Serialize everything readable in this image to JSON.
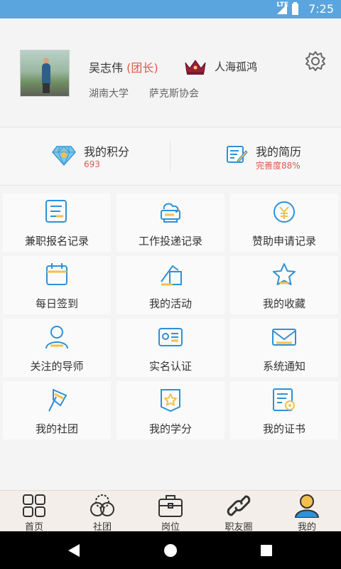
{
  "statusbar": {
    "network": "LTE",
    "time": "7:25"
  },
  "profile": {
    "name": "吴志伟",
    "role": "(团长)",
    "nickname": "人海孤鸿",
    "school": "湖南大学",
    "club": "萨克斯协会"
  },
  "stats": {
    "points_title": "我的积分",
    "points_value": "693",
    "resume_title": "我的简历",
    "resume_value": "完善度88%"
  },
  "menu": [
    {
      "label": "兼职报名记录",
      "icon": "form-record-icon"
    },
    {
      "label": "工作投递记录",
      "icon": "print-deliver-icon"
    },
    {
      "label": "赞助申请记录",
      "icon": "yuan-coin-icon"
    },
    {
      "label": "每日签到",
      "icon": "calendar-icon"
    },
    {
      "label": "我的活动",
      "icon": "activity-icon"
    },
    {
      "label": "我的收藏",
      "icon": "star-icon"
    },
    {
      "label": "关注的导师",
      "icon": "person-icon"
    },
    {
      "label": "实名认证",
      "icon": "id-card-icon"
    },
    {
      "label": "系统通知",
      "icon": "envelope-icon"
    },
    {
      "label": "我的社团",
      "icon": "club-flag-icon"
    },
    {
      "label": "我的学分",
      "icon": "credit-badge-icon"
    },
    {
      "label": "我的证书",
      "icon": "certificate-icon"
    }
  ],
  "tabs": [
    {
      "label": "首页",
      "icon": "home-grid-icon"
    },
    {
      "label": "社团",
      "icon": "circles-icon"
    },
    {
      "label": "岗位",
      "icon": "briefcase-icon"
    },
    {
      "label": "职友圈",
      "icon": "link-icon"
    },
    {
      "label": "我的",
      "icon": "user-icon",
      "active": true
    }
  ],
  "colors": {
    "accent": "#5aa5dd",
    "highlight": "#e0584f",
    "icon_blue": "#2f91d6",
    "icon_yellow": "#f4c04c"
  }
}
